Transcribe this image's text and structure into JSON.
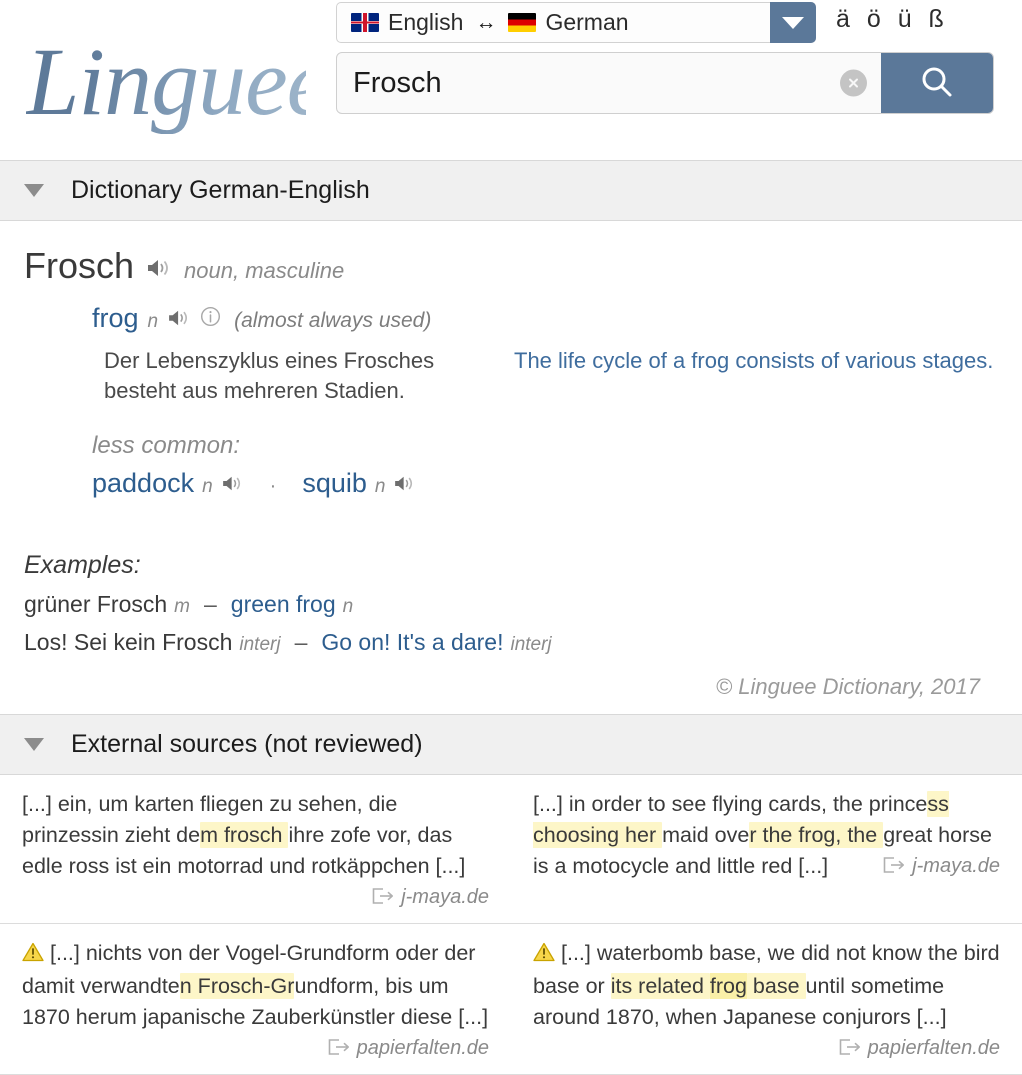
{
  "header": {
    "logo_text": "Linguee",
    "language_selector": {
      "source_lang": "English",
      "source_flag": "flag-gb-icon",
      "swap_symbol": "↔",
      "target_lang": "German",
      "target_flag": "flag-de-icon",
      "dropdown_icon": "chevron-down-icon"
    },
    "special_chars": "ä ö ü ß",
    "search": {
      "value": "Frosch",
      "placeholder": "",
      "clear_icon": "clear-x-icon",
      "search_icon": "magnifier-icon"
    }
  },
  "dictionary_section": {
    "collapse_icon": "triangle-down-icon",
    "title": "Dictionary German-English",
    "entry": {
      "headword": "Frosch",
      "audio_icon": "speaker-icon",
      "part_of_speech": "noun, masculine",
      "primary_translation": {
        "word": "frog",
        "gram": "n",
        "audio_icon": "speaker-icon",
        "info_icon": "info-circle-icon",
        "usage_note": "(almost always used)",
        "example_source": "Der Lebenszyklus eines Frosches besteht aus mehreren Stadien.",
        "example_target": "The life cycle of a frog consists of various stages."
      },
      "less_common_label": "less common:",
      "less_common": [
        {
          "word": "paddock",
          "gram": "n",
          "audio_icon": "speaker-icon"
        },
        {
          "word": "squib",
          "gram": "n",
          "audio_icon": "speaker-icon"
        }
      ],
      "less_common_separator": "·",
      "examples_heading": "Examples:",
      "examples": [
        {
          "source": "grüner Frosch",
          "source_gram": "m",
          "dash": "–",
          "target": "green frog",
          "target_gram": "n"
        },
        {
          "source": "Los! Sei kein Frosch",
          "source_gram": "interj",
          "dash": "–",
          "target": "Go on! It's a dare!",
          "target_gram": "interj"
        }
      ],
      "copyright": "© Linguee Dictionary, 2017"
    }
  },
  "external_section": {
    "collapse_icon": "triangle-down-icon",
    "title": "External sources (not reviewed)",
    "rows": [
      {
        "source": {
          "warning": false,
          "segments": [
            {
              "t": "[...] ein, um karten fliegen zu sehen, die prinzessin zieht de",
              "h": 0
            },
            {
              "t": "m frosch ",
              "h": 1
            },
            {
              "t": "ihre zofe vor, das edle ross ist ein motorrad und rotkäppchen [...]",
              "h": 0
            }
          ],
          "link_icon": "external-link-icon",
          "site": "j-maya.de"
        },
        "target": {
          "warning": false,
          "segments": [
            {
              "t": "[...] in order to see flying cards, the prince",
              "h": 0
            },
            {
              "t": "ss choosing her ",
              "h": 1
            },
            {
              "t": "maid ove",
              "h": 0
            },
            {
              "t": "r the frog, the ",
              "h": 1
            },
            {
              "t": "great horse is a motocycle and little red [...]",
              "h": 0
            }
          ],
          "link_icon": "external-link-icon",
          "site": "j-maya.de"
        }
      },
      {
        "source": {
          "warning": true,
          "warning_icon": "warning-triangle-icon",
          "segments": [
            {
              "t": "[...] nichts von der Vogel-Grundform oder der damit verwandte",
              "h": 0
            },
            {
              "t": "n Frosch-Gr",
              "h": 1
            },
            {
              "t": "undform, bis um 1870 herum japanische Zauberkünstler diese [...]",
              "h": 0
            }
          ],
          "link_icon": "external-link-icon",
          "site": "papierfalten.de"
        },
        "target": {
          "warning": true,
          "warning_icon": "warning-triangle-icon",
          "segments": [
            {
              "t": "[...] waterbomb base, we did not know the bird base or ",
              "h": 0
            },
            {
              "t": "its related ",
              "h": 1
            },
            {
              "t": "frog",
              "h": 2
            },
            {
              "t": " base ",
              "h": 1
            },
            {
              "t": "until sometime around 1870, when Japanese conjurors [...]",
              "h": 0
            }
          ],
          "link_icon": "external-link-icon",
          "site": "papierfalten.de"
        }
      }
    ]
  },
  "colors": {
    "accent_blue": "#5b7899",
    "link_blue": "#2d5d8e",
    "highlight_yellow": "#fdf6c8",
    "section_bg": "#f0f0f0",
    "text_dark": "#3a3a3a",
    "text_muted": "#8a8a8a"
  }
}
